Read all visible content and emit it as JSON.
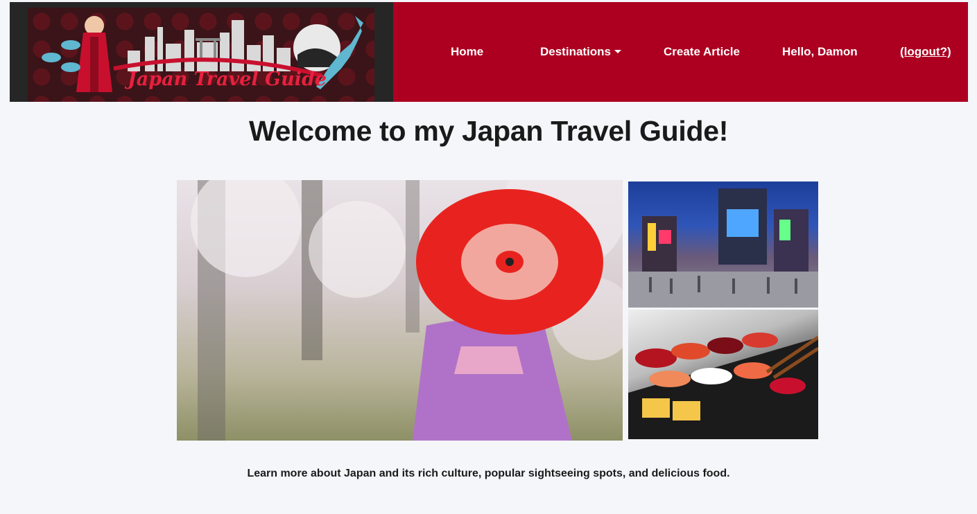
{
  "logo": {
    "text": "Japan Travel Guide"
  },
  "nav": {
    "home": "Home",
    "destinations": "Destinations",
    "create_article": "Create Article",
    "greeting": "Hello, Damon",
    "logout": "(logout?)"
  },
  "main": {
    "title": "Welcome to my Japan Travel Guide!",
    "tagline": "Learn more about Japan and its rich culture, popular sightseeing spots, and delicious food."
  },
  "colors": {
    "nav_background": "#ad0021",
    "logo_background": "#262626",
    "page_background": "#f4f6f9"
  }
}
